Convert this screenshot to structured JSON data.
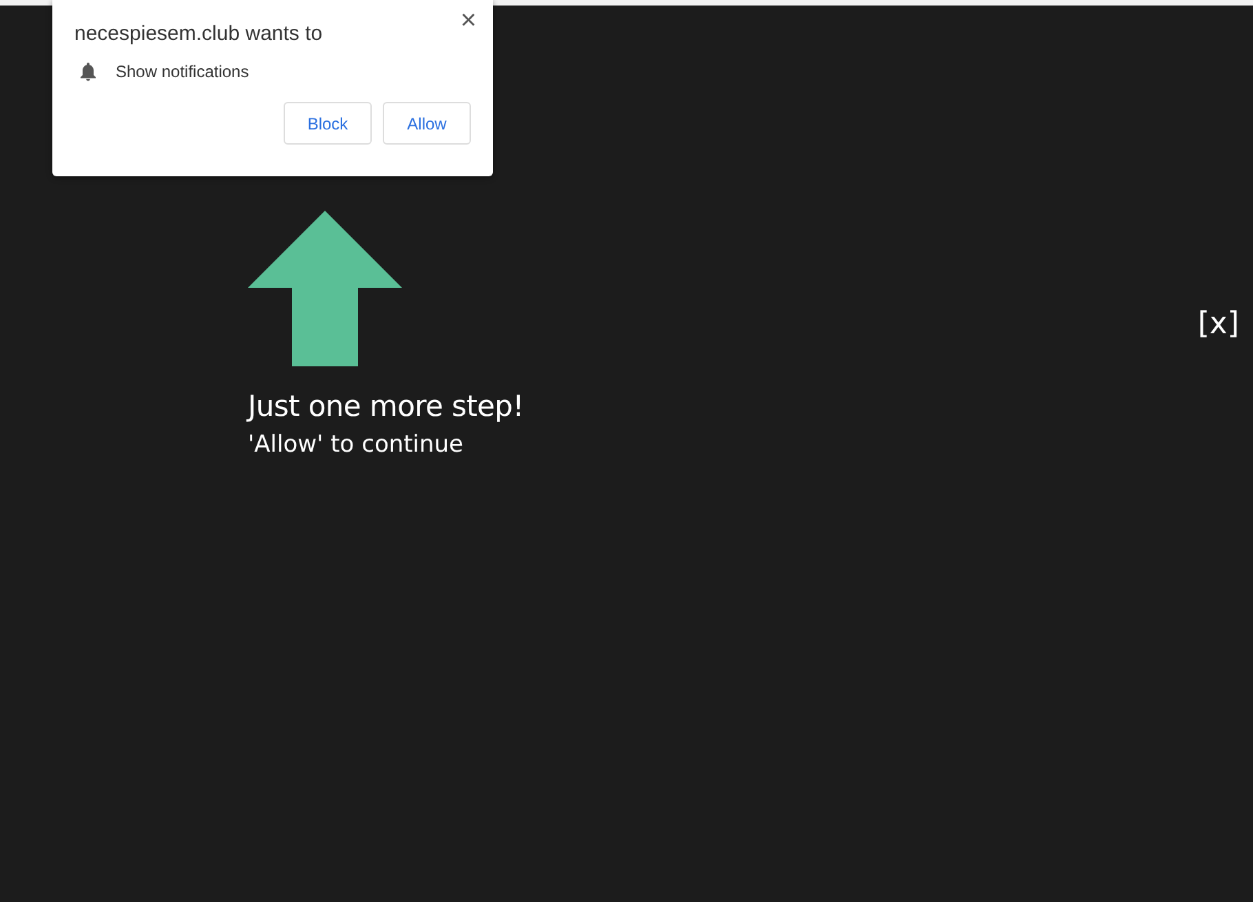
{
  "popup": {
    "title": "necespiesem.club wants to",
    "permission": "Show notifications",
    "buttons": [
      "Block",
      "Allow"
    ],
    "close": "×"
  },
  "page": {
    "heading": "Just one more step!",
    "subheading": "'Allow' to continue",
    "close": "[x]"
  }
}
